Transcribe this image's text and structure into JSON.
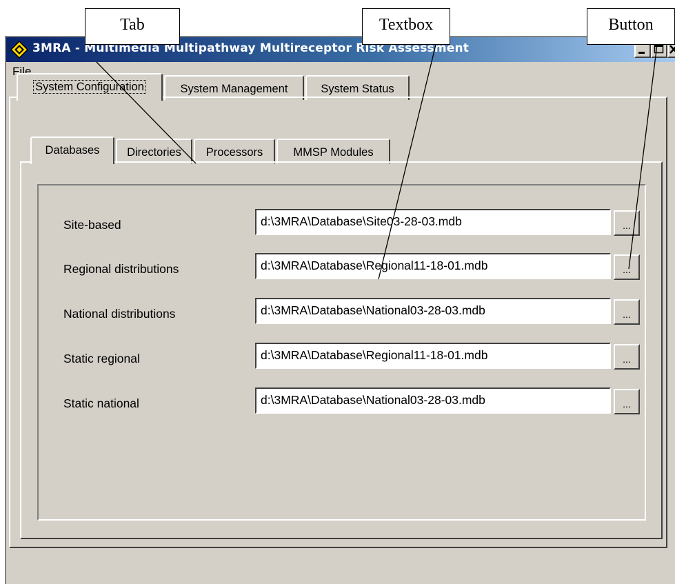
{
  "callouts": {
    "tab": "Tab",
    "textbox": "Textbox",
    "button": "Button"
  },
  "window": {
    "title": "3MRA - Multimedia Multipathway Multireceptor Risk Assessment",
    "caption_buttons": [
      "minimize-icon",
      "maximize-icon",
      "close-icon"
    ]
  },
  "menu": {
    "items": [
      {
        "label": "File"
      }
    ]
  },
  "main_tabs": [
    {
      "label": "System Configuration",
      "selected": true
    },
    {
      "label": "System Management",
      "selected": false
    },
    {
      "label": "System Status",
      "selected": false
    }
  ],
  "sub_tabs": [
    {
      "label": "Databases",
      "selected": true
    },
    {
      "label": "Directories",
      "selected": false
    },
    {
      "label": "Processors",
      "selected": false
    },
    {
      "label": "MMSP Modules",
      "selected": false
    }
  ],
  "fields": [
    {
      "label": "Site-based",
      "value": "d:\\3MRA\\Database\\Site03-28-03.mdb",
      "button": "..."
    },
    {
      "label": "Regional distributions",
      "value": "d:\\3MRA\\Database\\Regional11-18-01.mdb",
      "button": "..."
    },
    {
      "label": "National distributions",
      "value": "d:\\3MRA\\Database\\National03-28-03.mdb",
      "button": "..."
    },
    {
      "label": "Static regional",
      "value": "d:\\3MRA\\Database\\Regional11-18-01.mdb",
      "button": "..."
    },
    {
      "label": "Static national",
      "value": "d:\\3MRA\\Database\\National03-28-03.mdb",
      "button": "..."
    }
  ],
  "colors": {
    "face": "#d4d0c8",
    "titlebar_start": "#0a246a",
    "titlebar_end": "#a6caf0",
    "title_text": "#ffffff",
    "icon_yellow": "#ffd700"
  }
}
